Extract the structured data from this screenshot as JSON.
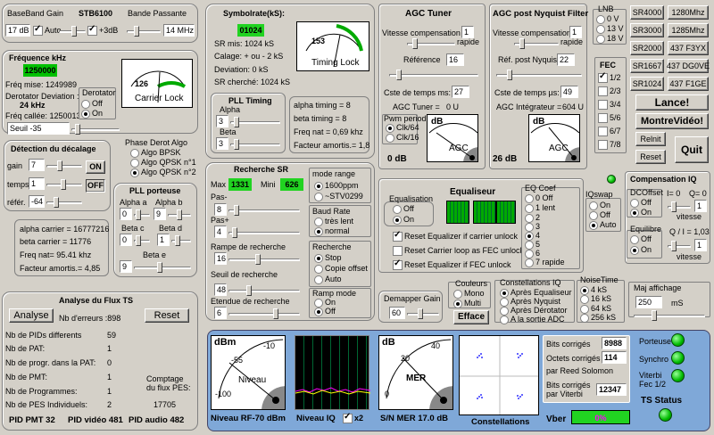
{
  "bb": {
    "title": "BaseBand Gain",
    "model": "STB6100",
    "bandTitle": "Bande Passante",
    "gain": "17 dB",
    "auto": "Auto",
    "plus3": "+3dB",
    "bw": "14 MHz"
  },
  "freq": {
    "title": "Fréquence kHz",
    "val": "1250000",
    "mise": "Fréq mise: 1249989",
    "devLabel": "Derotator Deviation :",
    "dev": "24 kHz",
    "callee": "Fréq callée: 1250013",
    "seuil": "Seuil -35",
    "derot": "Derotator",
    "off": "Off",
    "on": "On",
    "meter": "Carrier Lock",
    "mval": "126"
  },
  "sym": {
    "title": "Symbolrate(kS):",
    "val": "01024",
    "mis": "SR mis: 1024 kS",
    "calage": "Calage: + ou - 2 kS",
    "deviation": "Deviation:   0 kS",
    "cherche": "SR cherché: 1024 kS",
    "meter": "Timing Lock",
    "mval": "153"
  },
  "timing": {
    "title": "PLL Timing",
    "alpha": "Alpha",
    "alphaV": "3",
    "beta": "Beta",
    "betaV": "3",
    "a": "alpha timing = 8",
    "b": "beta timing = 8",
    "f": "Freq nat = 0,69 khz",
    "fa": "Facteur amortis.= 1,8"
  },
  "detect": {
    "title": "Détection du décalage",
    "gain": "gain",
    "gainV": "7",
    "temps": "temps",
    "tempsV": "1",
    "refer": "référ.",
    "referV": "-64",
    "on": "ON",
    "off": "OFF"
  },
  "phase": {
    "title": "Phase Derot Algo",
    "o1": "Algo BPSK",
    "o2": "Algo QPSK n°1",
    "o3": "Algo QPSK n°2"
  },
  "pll": {
    "title": "PLL porteuse",
    "aa": "Alpha a",
    "aaV": "0",
    "ab": "Alpha b",
    "abV": "9",
    "bc": "Beta c",
    "bcV": "0",
    "bd": "Beta d",
    "bdV": "1",
    "be": "Beta e",
    "beV": "9"
  },
  "carrier": {
    "a": "alpha carrier = 16777216",
    "b": "beta carrier = 11776",
    "f": "Freq nat= 95.41 khz",
    "fa": "Facteur amortis.= 4,85"
  },
  "ts": {
    "title": "Analyse du Flux TS",
    "analyse": "Analyse",
    "err": "Nb d'erreurs :898",
    "reset": "Reset",
    "r1": "Nb de  PIDs differents",
    "v1": "59",
    "r2": "Nb de PAT:",
    "v2": "1",
    "r3": "Nb de progr. dans la PAT:",
    "v3": "0",
    "r4": "Nb de PMT:",
    "v4": "1",
    "r5": "Nb de Programmes:",
    "v5": "1",
    "r6": "Nb de PES Individuels:",
    "v6": "2",
    "pes": "Comptage du flux PES:",
    "pesV": "17705",
    "pmt": "PID PMT 32",
    "vid": "PID vidéo 481",
    "aud": "PID audio 482"
  },
  "recherche": {
    "title": "Recherche SR",
    "max": "Max",
    "maxV": "1331",
    "mini": "Mini",
    "miniV": "626",
    "pasm": "Pas-",
    "pasmV": "8",
    "pasp": "Pas+",
    "paspV": "4",
    "rampe": "Rampe de recherche",
    "rampeV": "16",
    "seuil": "Seuil de recherche",
    "seuilV": "48",
    "etendue": "Etendue de recherche",
    "etendueV": "6"
  },
  "mode": {
    "title": "mode range",
    "o1": "1600ppm",
    "o2": "~STV0299"
  },
  "baud": {
    "title": "Baud Rate",
    "o1": "très lent",
    "o2": "normal"
  },
  "rech2": {
    "title": "Recherche",
    "o1": "Stop",
    "o2": "Copie offset",
    "o3": "Auto"
  },
  "ramp": {
    "title": "Ramp mode",
    "o1": "On",
    "o2": "Off"
  },
  "agct": {
    "title": "AGC Tuner",
    "vit": "Vitesse compensation",
    "lent": "lente",
    "rapide": "rapide",
    "vitV": "1",
    "ref": "Référence",
    "refV": "16",
    "cste": "Cste de temps ms:",
    "csteV": "27",
    "agc": "AGC Tuner =",
    "agcV": "0 U",
    "pwm": "Pwm period",
    "p1": "Clk/64",
    "p2": "Clk/16",
    "db": "0 dB",
    "mdb": "dB",
    "magc": "AGC"
  },
  "agcn": {
    "title": "AGC post Nyquist Filter",
    "vit": "Vitesse compensation",
    "lent": "lente",
    "rapide": "rapide",
    "vitV": "1",
    "ref": "Réf. post Nyquist",
    "refV": "22",
    "cste": "Cste de temps µs:",
    "csteV": "49",
    "int": "AGC Intégrateur =",
    "intV": "604 U",
    "db": "26 dB",
    "mdb": "dB",
    "magc": "AGC"
  },
  "lnb": {
    "title": "LNB",
    "o1": "0 V",
    "o2": "13 V",
    "o3": "18 V"
  },
  "sr": [
    "SR4000",
    "1280Mhz",
    "SR3000",
    "1285Mhz",
    "SR2000",
    "437 F3YX",
    "SR1667",
    "437 DG0VE",
    "SR1024",
    "437 F1GE"
  ],
  "fec": {
    "title": "FEC",
    "o": [
      "1/2",
      "2/3",
      "3/4",
      "5/6",
      "6/7",
      "7/8"
    ]
  },
  "act": {
    "lance": "Lance!",
    "montre": "MontreVidéo!",
    "relnit": "Relnit",
    "reset": "Reset",
    "quit": "Quit"
  },
  "eq": {
    "title": "Equaliseur",
    "eqTitle": "Equalisation",
    "off": "Off",
    "on": "On",
    "c1": "Reset Equalizer if carrier unlock",
    "c2": "Reset Carrier loop as FEC unlock",
    "c3": "Reset Equalizer if FEC unlock"
  },
  "eqc": {
    "title": "EQ Coef",
    "o": [
      "0 Off",
      "1 lent",
      "2",
      "3",
      "4",
      "5",
      "6",
      "7 rapide"
    ]
  },
  "iq": {
    "title": "IQswap",
    "o1": "On",
    "o2": "Off",
    "o3": "Auto"
  },
  "comp": {
    "title": "Compensation IQ",
    "dc": "DCOffset",
    "off": "Off",
    "on": "On",
    "i": "I= 0",
    "q": "Q= 0",
    "v1": "vitesse",
    "eq": "Equilibre",
    "qi": "Q / I = 1,03",
    "v2": "vitesse",
    "iV": "1",
    "qV": "1"
  },
  "demap": {
    "title": "Demapper Gain",
    "val": "60"
  },
  "coul": {
    "title": "Couleurs",
    "o1": "Mono",
    "o2": "Multi",
    "eff": "Efface"
  },
  "const": {
    "title": "Constellations IQ",
    "o1": "Après Equaliseur",
    "o2": "Après Nyquist",
    "o3": "Après Dérotator",
    "o4": "A la sortie ADC"
  },
  "noise": {
    "title": "NoiseTime",
    "o": [
      "4 kS",
      "16 kS",
      "64 kS",
      "256 kS"
    ]
  },
  "maj": {
    "title": "Maj affichage",
    "val": "250",
    "unit": "mS"
  },
  "bottom": {
    "dbm": "dBm",
    "n55": "-55",
    "n10": "-10",
    "n100": "-100",
    "niveau": "Niveau",
    "rf": "Niveau RF-70 dBm",
    "iq": "Niveau IQ",
    "x2": "x2",
    "db": "dB",
    "m20": "20",
    "m40": "40",
    "m0": "0",
    "mer": "MER",
    "sn": "S/N MER  17.0 dB",
    "constel": "Constellations",
    "bc": "Bits corrigés",
    "bcV": "8988",
    "oc": "Octets corrigés",
    "ocV": "114",
    "rs": "par Reed Solomon",
    "bv": "Bits corrigés par Viterbi",
    "bvV": "12347",
    "vber": "Vber",
    "vberV": "0%",
    "porteuse": "Porteuse",
    "synchro": "Synchro",
    "viterbi": "Viterbi Fec 1/2",
    "status": "TS Status"
  },
  "colors": {
    "bg": "#d4d0c8",
    "green": "#21d321",
    "panel": "#7fa8d8"
  }
}
